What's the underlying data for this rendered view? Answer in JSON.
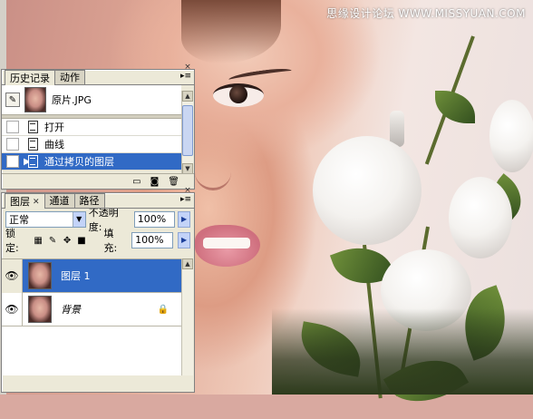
{
  "watermark": "思缘设计论坛 WWW.MISSYUAN.COM",
  "history_panel": {
    "tabs": [
      {
        "label": "历史记录",
        "active": true
      },
      {
        "label": "动作",
        "active": false
      }
    ],
    "snapshot": {
      "name": "原片.JPG"
    },
    "states": [
      {
        "label": "打开",
        "selected": false
      },
      {
        "label": "曲线",
        "selected": false
      },
      {
        "label": "通过拷贝的图层",
        "selected": true
      }
    ],
    "footer_icons": [
      "new-document-from-state-icon",
      "camera-snapshot-icon",
      "trash-icon"
    ]
  },
  "layers_panel": {
    "tabs": [
      {
        "label": "图层",
        "active": true
      },
      {
        "label": "通道",
        "active": false
      },
      {
        "label": "路径",
        "active": false
      }
    ],
    "blend_mode": "正常",
    "opacity_label": "不透明度:",
    "opacity_value": "100%",
    "lock_label": "锁定:",
    "fill_label": "填充:",
    "fill_value": "100%",
    "layers": [
      {
        "name": "图层 1",
        "selected": true,
        "visible": true,
        "locked": false
      },
      {
        "name": "背景",
        "selected": false,
        "visible": true,
        "locked": true
      }
    ]
  },
  "colors": {
    "selection": "#316ac5",
    "panel_bg": "#ece9d8"
  }
}
